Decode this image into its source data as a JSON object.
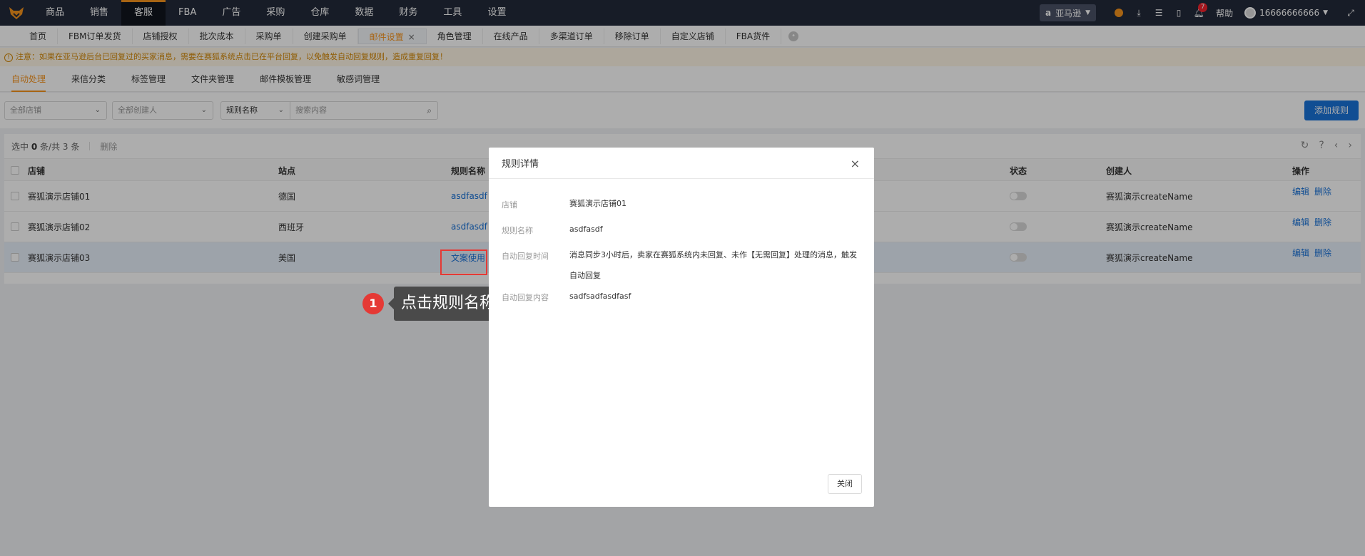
{
  "nav": {
    "items": [
      "商品",
      "销售",
      "客服",
      "FBA",
      "广告",
      "采购",
      "仓库",
      "数据",
      "财务",
      "工具",
      "设置"
    ],
    "active_index": 2,
    "platform": "亚马逊",
    "notification_count": "7",
    "help": "帮助",
    "user": "16666666666"
  },
  "tabs": {
    "items": [
      "首页",
      "FBM订单发货",
      "店铺授权",
      "批次成本",
      "采购单",
      "创建采购单",
      "邮件设置",
      "角色管理",
      "在线产品",
      "多渠道订单",
      "移除订单",
      "自定义店铺",
      "FBA货件"
    ],
    "active_index": 6,
    "close_glyph": "×"
  },
  "notice": "注意：如果在亚马逊后台已回复过的买家消息，需要在赛狐系统点击已在平台回复，以免触发自动回复规则，造成重复回复！",
  "subtabs": {
    "items": [
      "自动处理",
      "来信分类",
      "标签管理",
      "文件夹管理",
      "邮件模板管理",
      "敏感词管理"
    ],
    "active_index": 0
  },
  "filters": {
    "store_placeholder": "全部店铺",
    "creator_placeholder": "全部创建人",
    "rule_field": "规则名称",
    "search_placeholder": "搜索内容",
    "add_rule": "添加规则"
  },
  "table": {
    "selected_text_prefix": "选中",
    "selected_count": "0",
    "selected_text_mid": "条/共",
    "total_count": "3",
    "selected_text_suffix": "条",
    "delete_label": "删除",
    "columns": {
      "store": "店铺",
      "site": "站点",
      "rule": "规则名称",
      "status": "状态",
      "creator": "创建人",
      "actions": "操作"
    },
    "rows": [
      {
        "store": "赛狐演示店铺01",
        "site": "德国",
        "rule": "asdfasdf",
        "creator": "赛狐演示createName",
        "edit": "编辑",
        "del": "删除",
        "enabled": false
      },
      {
        "store": "赛狐演示店铺02",
        "site": "西班牙",
        "rule": "asdfasdf",
        "creator": "赛狐演示createName",
        "edit": "编辑",
        "del": "删除",
        "enabled": false
      },
      {
        "store": "赛狐演示店铺03",
        "site": "美国",
        "rule": "文案使用",
        "creator": "赛狐演示createName",
        "edit": "编辑",
        "del": "删除",
        "enabled": false
      }
    ]
  },
  "callout": {
    "step": "1",
    "text": "点击规则名称"
  },
  "modal": {
    "title": "规则详情",
    "close": "关闭",
    "store_label": "店铺",
    "store_value": "赛狐演示店铺01",
    "rule_label": "规则名称",
    "rule_value": "asdfasdf",
    "time_label": "自动回复时间",
    "time_value": "消息同步3小时后，卖家在赛狐系统内未回复、未作【无需回复】处理的消息，触发自动回复",
    "content_label": "自动回复内容",
    "content_value": "sadfsadfasdfasf"
  },
  "colors": {
    "accent": "#f7941d",
    "link": "#1a73d9",
    "nav_bg": "#232a3a",
    "highlight": "#e53935"
  }
}
